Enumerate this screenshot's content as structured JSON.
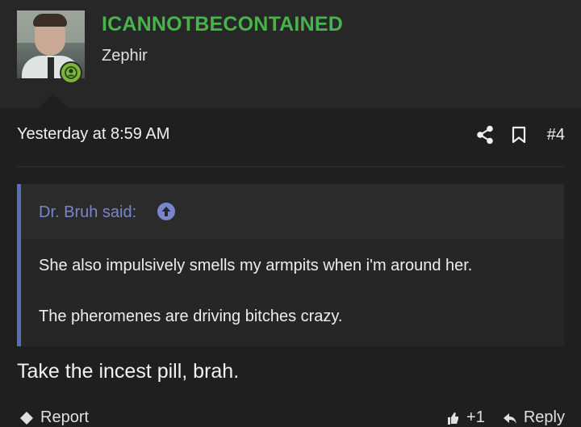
{
  "author": {
    "username": "ICANNOTBECONTAINED",
    "title": "Zephir",
    "avatar_icon": "user-avatar",
    "status_icon": "online-user-icon",
    "status_color": "#7cb53c",
    "username_color": "#47b34a"
  },
  "post": {
    "timestamp": "Yesterday at 8:59 AM",
    "number": "#4",
    "share_icon": "share-icon",
    "bookmark_icon": "bookmark-icon"
  },
  "quote": {
    "author_label": "Dr. Bruh said:",
    "jump_icon": "arrow-up-circle-icon",
    "lines": [
      "She also impulsively smells my armpits when i'm around her.",
      "The pheromenes are driving bitches crazy."
    ],
    "accent_color": "#5c6bc0"
  },
  "reply": {
    "text": "Take the incest pill, brah."
  },
  "footer": {
    "report_label": "Report",
    "like_label": "+1",
    "reply_label": "Reply"
  }
}
